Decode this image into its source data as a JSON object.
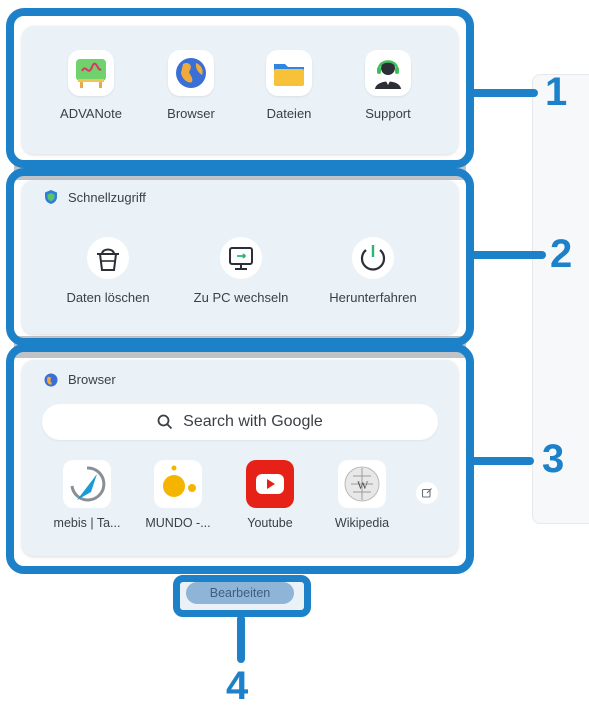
{
  "apps": [
    {
      "label": "ADVANote",
      "icon": "advanote-icon"
    },
    {
      "label": "Browser",
      "icon": "browser-globe-icon"
    },
    {
      "label": "Dateien",
      "icon": "folder-icon"
    },
    {
      "label": "Support",
      "icon": "support-headset-icon"
    }
  ],
  "quick_access": {
    "title": "Schnellzugriff",
    "items": [
      {
        "label": "Daten löschen",
        "icon": "clean-bucket-icon"
      },
      {
        "label": "Zu PC wechseln",
        "icon": "monitor-icon"
      },
      {
        "label": "Herunterfahren",
        "icon": "power-icon"
      }
    ]
  },
  "browser_section": {
    "title": "Browser",
    "search_placeholder": "Search with Google",
    "bookmarks": [
      {
        "label": "mebis | Ta...",
        "icon": "mebis-icon"
      },
      {
        "label": "MUNDO -...",
        "icon": "mundo-icon"
      },
      {
        "label": "Youtube",
        "icon": "youtube-icon"
      },
      {
        "label": "Wikipedia",
        "icon": "wikipedia-icon"
      }
    ]
  },
  "edit_button": "Bearbeiten",
  "annotations": [
    "1",
    "2",
    "3",
    "4"
  ],
  "colors": {
    "accent": "#1d81c9",
    "panel": "#eaf2f8",
    "youtube": "#e62117"
  }
}
